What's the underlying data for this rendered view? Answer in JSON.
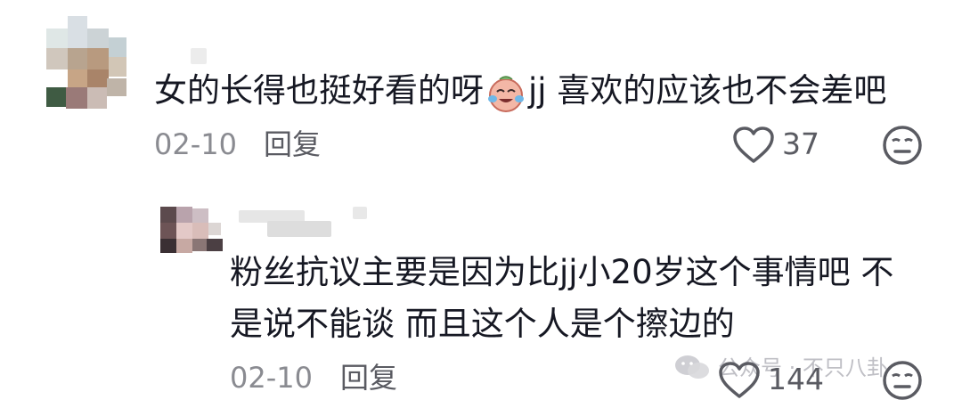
{
  "comments": [
    {
      "text_before": "女的长得也挺好看的呀",
      "text_after": "jj 喜欢的应该也不会差吧",
      "date": "02-10",
      "reply_label": "回复",
      "likes": "37",
      "emoji": "crying-laughing-emoji"
    }
  ],
  "replies": [
    {
      "line1": "粉丝抗议主要是因为比jj小20岁这个事情吧 不",
      "line2": "是说不能谈 而且这个人是个擦边的",
      "date": "02-10",
      "reply_label": "回复",
      "likes": "144"
    }
  ],
  "watermark": {
    "text": "公众号 · 不只八卦"
  },
  "colors": {
    "text": "#161823",
    "meta": "#8a8b91",
    "icon": "#5a5b62"
  }
}
